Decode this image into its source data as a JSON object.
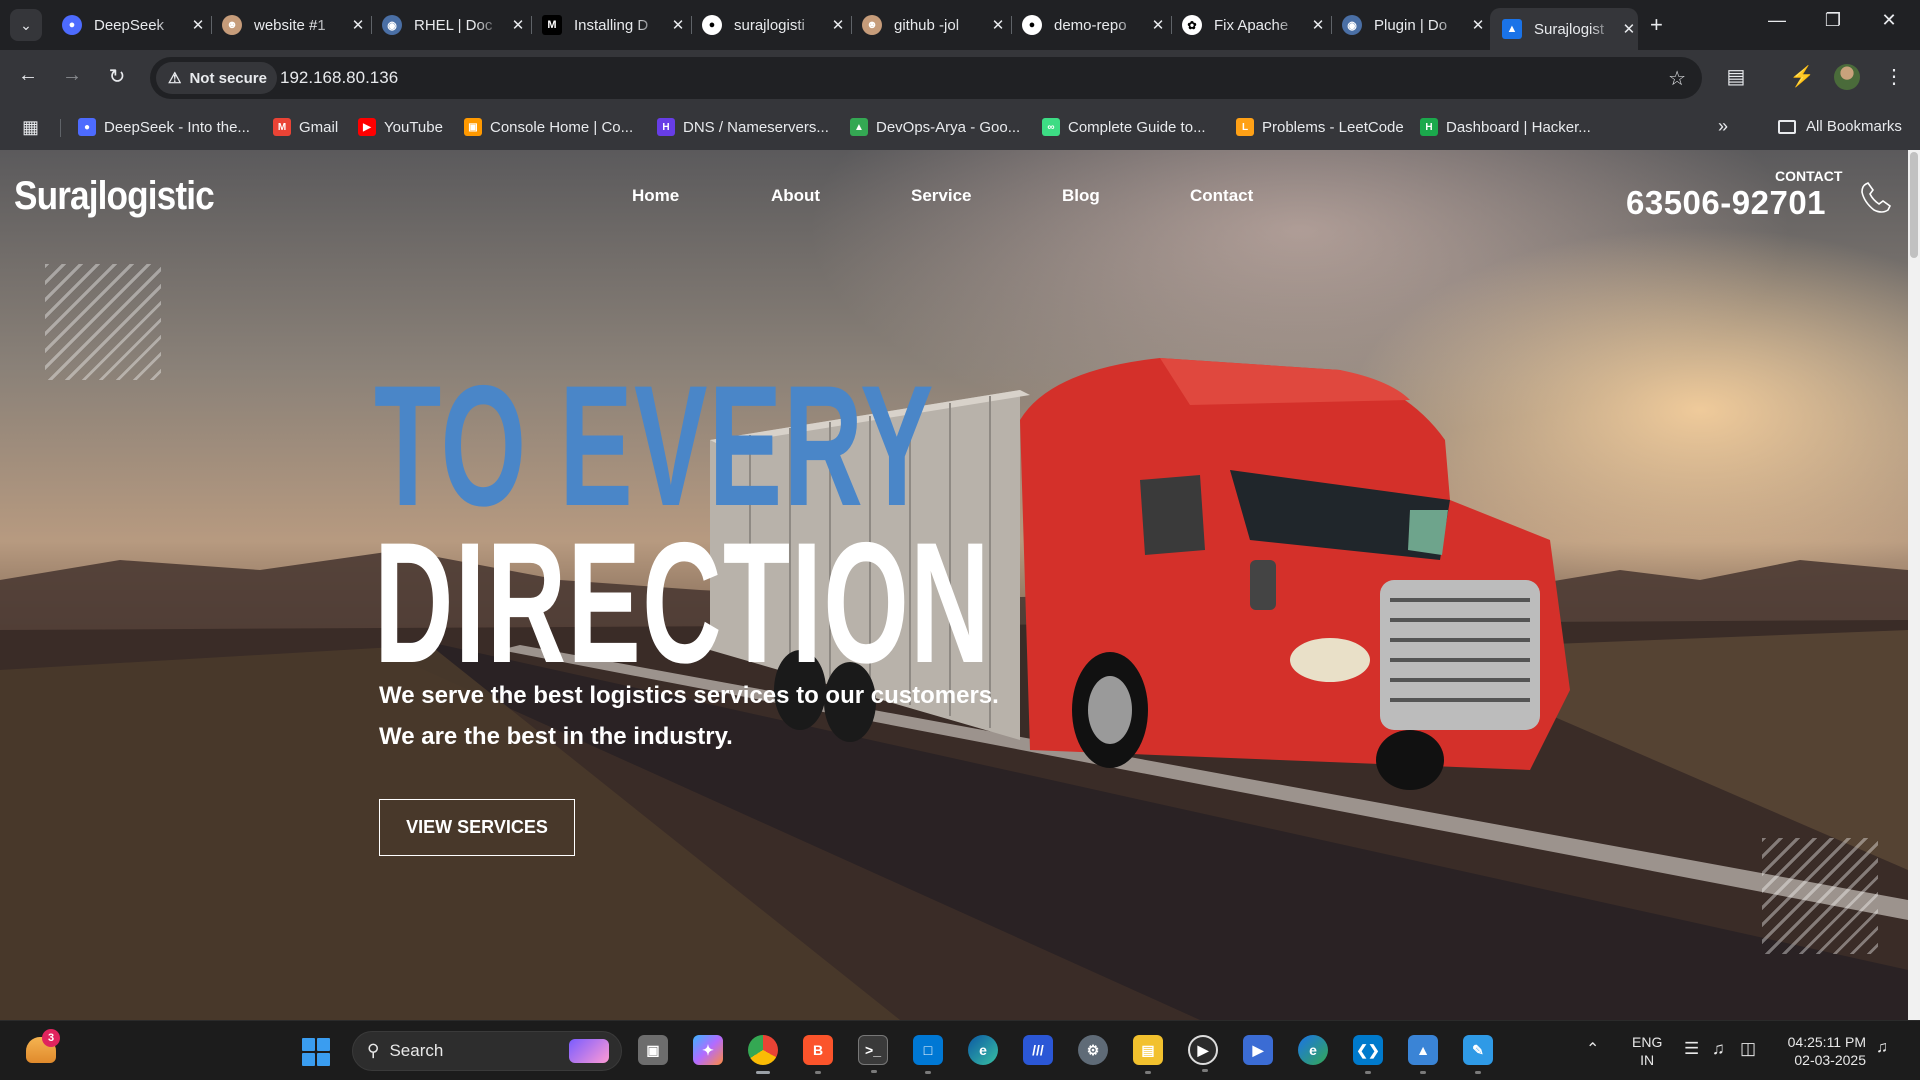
{
  "browser": {
    "tabs": [
      {
        "title": "DeepSeek",
        "icon": "deepseek-icon",
        "color": "#4d6bfe"
      },
      {
        "title": "website #1",
        "icon": "avatar-icon",
        "color": "#c69c7a"
      },
      {
        "title": "RHEL | Doc",
        "icon": "rhel-icon",
        "color": "#4a6fa5"
      },
      {
        "title": "Installing D",
        "icon": "medium-icon",
        "color": "#000000"
      },
      {
        "title": "surajlogisti",
        "icon": "github-icon",
        "color": "#ffffff"
      },
      {
        "title": "github -jol",
        "icon": "avatar-icon",
        "color": "#c69c7a"
      },
      {
        "title": "demo-repo",
        "icon": "github-icon",
        "color": "#ffffff"
      },
      {
        "title": "Fix Apache",
        "icon": "openai-icon",
        "color": "#ffffff"
      },
      {
        "title": "Plugin | Do",
        "icon": "rhel-icon",
        "color": "#4a6fa5"
      },
      {
        "title": "Surajlogist",
        "icon": "site-icon",
        "color": "#1a73e8",
        "active": true
      }
    ],
    "security_label": "Not secure",
    "url": "192.168.80.136",
    "bookmarks": [
      {
        "label": "DeepSeek - Into the...",
        "icon": "deepseek-icon",
        "color": "#4d6bfe"
      },
      {
        "label": "Gmail",
        "icon": "gmail-icon",
        "color": "#ea4335"
      },
      {
        "label": "YouTube",
        "icon": "youtube-icon",
        "color": "#ff0000"
      },
      {
        "label": "Console Home | Co...",
        "icon": "aws-icon",
        "color": "#ff9900"
      },
      {
        "label": "DNS / Nameservers...",
        "icon": "hostinger-icon",
        "color": "#673de6"
      },
      {
        "label": "DevOps-Arya - Goo...",
        "icon": "drive-icon",
        "color": "#34a853"
      },
      {
        "label": "Complete Guide to...",
        "icon": "link-icon",
        "color": "#3ddc84"
      },
      {
        "label": "Problems - LeetCode",
        "icon": "leetcode-icon",
        "color": "#ffa116"
      },
      {
        "label": "Dashboard | Hacker...",
        "icon": "hackerrank-icon",
        "color": "#1ba94c"
      }
    ],
    "all_bookmarks_label": "All Bookmarks"
  },
  "site": {
    "logo": "Surajlogistic",
    "nav": [
      "Home",
      "About",
      "Service",
      "Blog",
      "Contact"
    ],
    "contact_label": "CONTACT",
    "contact_phone": "63506-92701",
    "hero_line1": "TO EVERY",
    "hero_line2": "DIRECTION",
    "hero_sub1": "We serve the best logistics services to our customers.",
    "hero_sub2": "We are the best in the industry.",
    "cta_label": "VIEW SERVICES",
    "accent_color": "#4a86c8"
  },
  "taskbar": {
    "weather_badge": "3",
    "search_placeholder": "Search",
    "lang_line1": "ENG",
    "lang_line2": "IN",
    "time": "04:25:11 PM",
    "date": "02-03-2025"
  }
}
